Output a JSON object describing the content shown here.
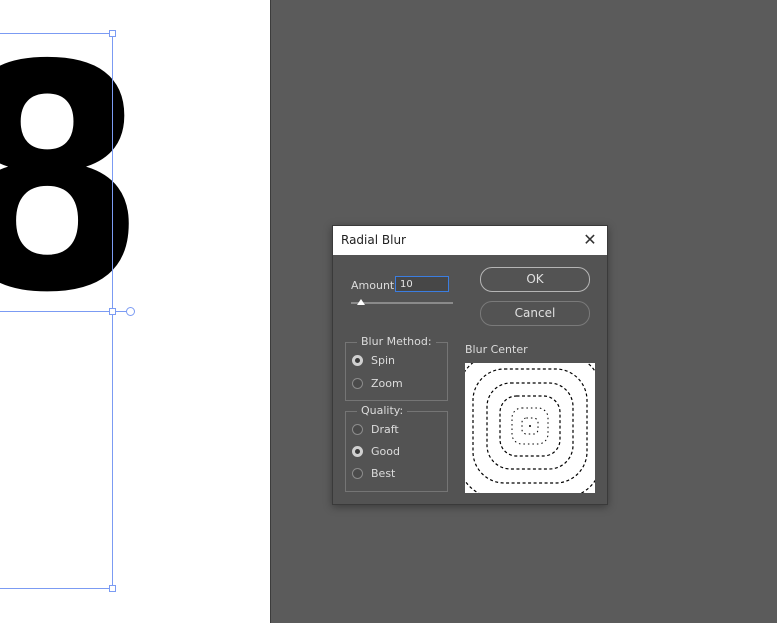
{
  "canvas": {
    "glyph_text": "8"
  },
  "dialog": {
    "title": "Radial Blur",
    "close_glyph": "✕",
    "amount": {
      "label": "Amount",
      "value": "10",
      "slider_fraction": 0.1
    },
    "buttons": {
      "ok": "OK",
      "cancel": "Cancel"
    },
    "blur_method": {
      "label": "Blur Method:",
      "options": [
        "Spin",
        "Zoom"
      ],
      "selected": "Spin"
    },
    "quality": {
      "label": "Quality:",
      "options": [
        "Draft",
        "Good",
        "Best"
      ],
      "selected": "Good"
    },
    "blur_center": {
      "label": "Blur Center"
    }
  },
  "colors": {
    "workspace": "#5b5b5b",
    "dialog_bg": "#535353",
    "guide": "#7b9bf3",
    "input_focus": "#3b7de0"
  },
  "icons": [
    "close-icon"
  ]
}
